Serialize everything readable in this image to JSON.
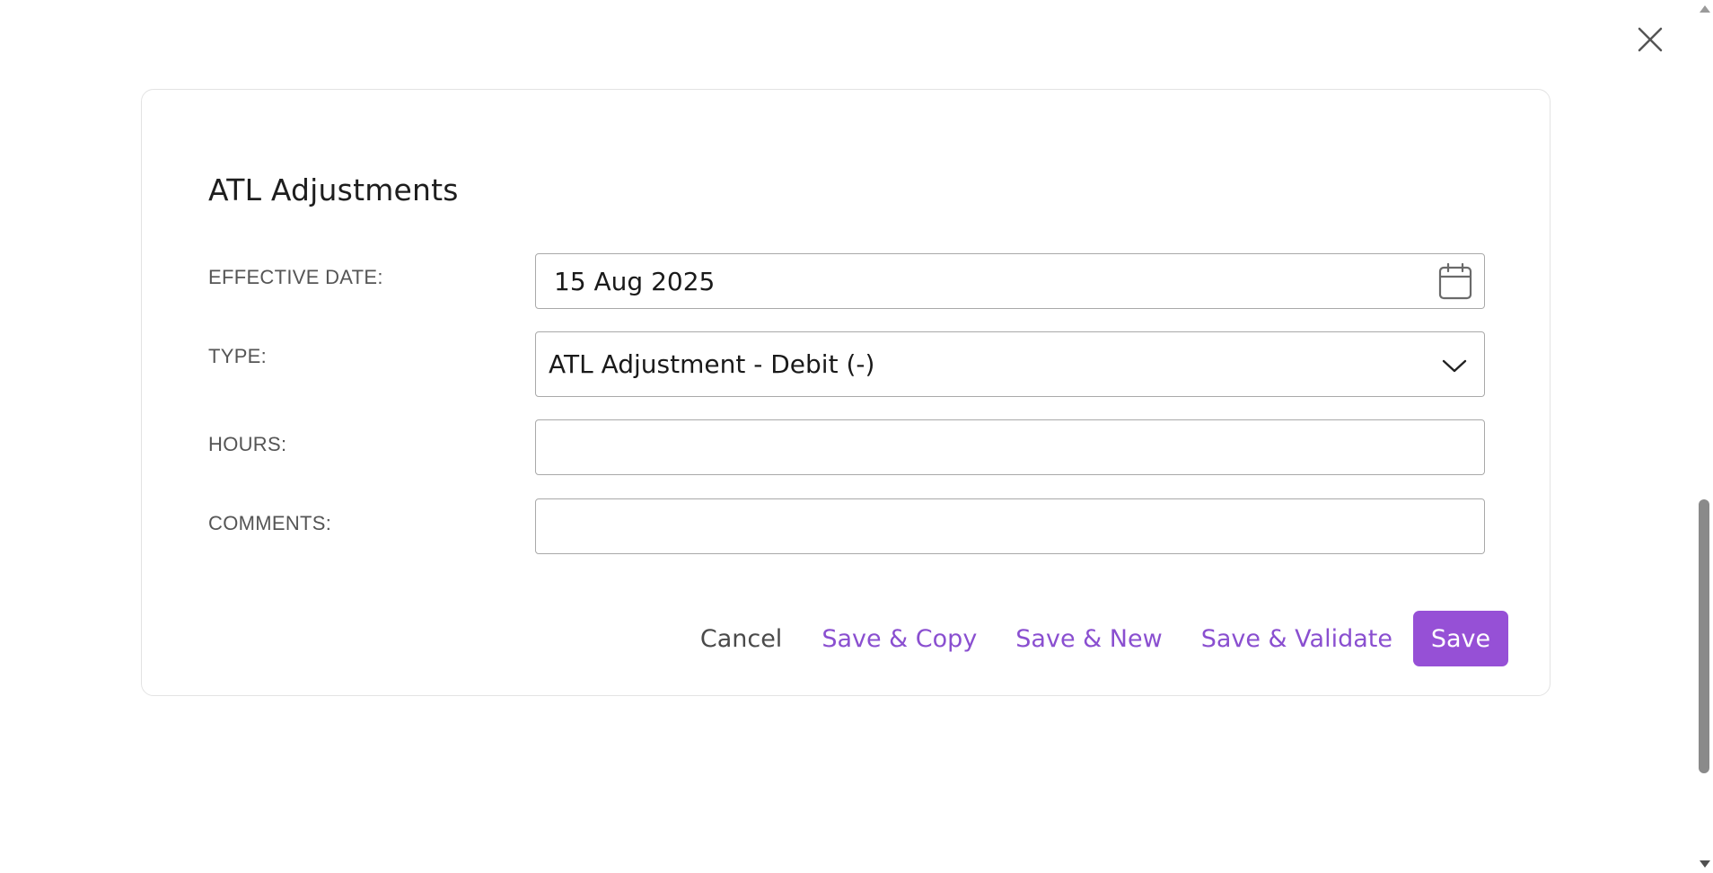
{
  "dialog": {
    "title": "ATL Adjustments",
    "close_icon": "close-icon"
  },
  "form": {
    "effective_date": {
      "label": "EFFECTIVE DATE:",
      "value": "15 Aug 2025",
      "icon": "calendar-icon"
    },
    "type": {
      "label": "TYPE:",
      "selected": "ATL Adjustment - Debit (-)",
      "icon": "chevron-down-icon"
    },
    "hours": {
      "label": "HOURS:",
      "value": ""
    },
    "comments": {
      "label": "COMMENTS:",
      "value": ""
    }
  },
  "actions": {
    "cancel": "Cancel",
    "save_copy": "Save & Copy",
    "save_new": "Save & New",
    "save_validate": "Save & Validate",
    "save": "Save"
  },
  "colors": {
    "accent": "#9650d6",
    "link": "#8a4fd0",
    "label": "#555555",
    "border": "#a9a9a9"
  }
}
